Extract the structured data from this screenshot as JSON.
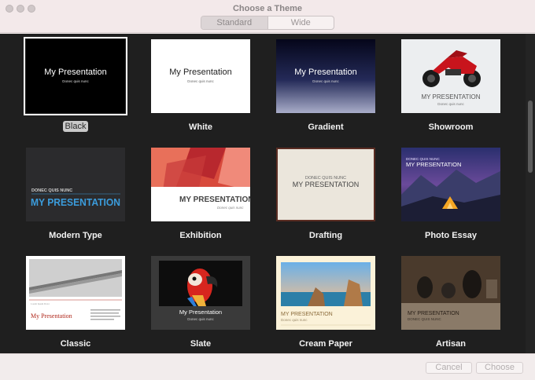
{
  "window": {
    "title": "Choose a Theme"
  },
  "segments": [
    {
      "label": "Standard",
      "active": true
    },
    {
      "label": "Wide",
      "active": false
    }
  ],
  "themes": [
    {
      "name": "Black",
      "selected": true,
      "preview_title": "My Presentation",
      "preview_subtitle": "Donec quis nunc"
    },
    {
      "name": "White",
      "preview_title": "My Presentation",
      "preview_subtitle": "Donec quis nunc"
    },
    {
      "name": "Gradient",
      "preview_title": "My Presentation",
      "preview_subtitle": "Donec quis nunc"
    },
    {
      "name": "Showroom",
      "preview_title": "MY PRESENTATION",
      "preview_subtitle": "Donec quis nunc"
    },
    {
      "name": "Modern Type",
      "preview_title": "MY PRESENTATION",
      "preview_subtitle": "DONEC QUIS NUNC"
    },
    {
      "name": "Exhibition",
      "preview_title": "MY PRESENTATION",
      "preview_subtitle": "Donec quis nunc"
    },
    {
      "name": "Drafting",
      "preview_title": "MY PRESENTATION",
      "preview_subtitle": "DONEC QUIS NUNC"
    },
    {
      "name": "Photo Essay",
      "preview_title": "MY PRESENTATION",
      "preview_subtitle": "DONEC QUIS NUNC"
    },
    {
      "name": "Classic",
      "preview_title": "My Presentation",
      "preview_subtitle": "Lorem Ipsum Dolor"
    },
    {
      "name": "Slate",
      "preview_title": "My Presentation",
      "preview_subtitle": "Donec quis nunc"
    },
    {
      "name": "Cream Paper",
      "preview_title": "MY PRESENTATION",
      "preview_subtitle": "Donec quis nunc"
    },
    {
      "name": "Artisan",
      "preview_title": "MY PRESENTATION",
      "preview_subtitle": "DONEC QUIS NUNC"
    }
  ],
  "buttons": {
    "cancel": "Cancel",
    "choose": "Choose"
  },
  "colors": {
    "modern_type_accent": "#3b9cdc",
    "classic_accent": "#b0281c",
    "background": "#1f1f1f"
  }
}
